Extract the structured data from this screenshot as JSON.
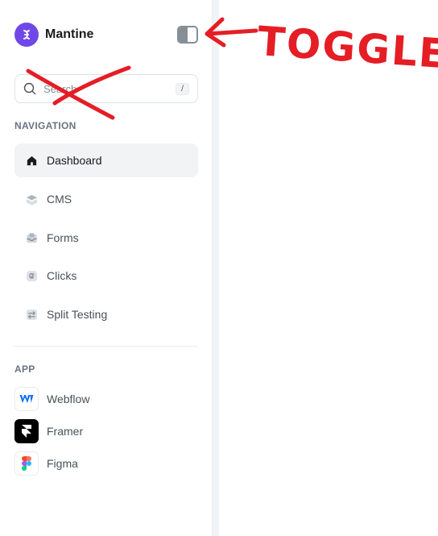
{
  "app": {
    "name": "Mantine"
  },
  "search": {
    "placeholder": "Search",
    "shortcut": "/"
  },
  "navigation": {
    "label": "NAVIGATION",
    "items": [
      {
        "label": "Dashboard",
        "icon": "home-icon",
        "active": true
      },
      {
        "label": "CMS",
        "icon": "layers-icon",
        "active": false
      },
      {
        "label": "Forms",
        "icon": "inbox-icon",
        "active": false
      },
      {
        "label": "Clicks",
        "icon": "swirl-icon",
        "active": false
      },
      {
        "label": "Split Testing",
        "icon": "arrows-swap-icon",
        "active": false
      }
    ]
  },
  "apps": {
    "label": "APP",
    "items": [
      {
        "label": "Webflow",
        "icon": "webflow-logo-icon"
      },
      {
        "label": "Framer",
        "icon": "framer-logo-icon"
      },
      {
        "label": "Figma",
        "icon": "figma-logo-icon"
      }
    ]
  },
  "annotation": {
    "text": "TOGGLE",
    "color": "#e51d25"
  },
  "colors": {
    "brand": "#7048e8",
    "active_bg": "#f1f3f5",
    "muted_text": "#868e96"
  }
}
